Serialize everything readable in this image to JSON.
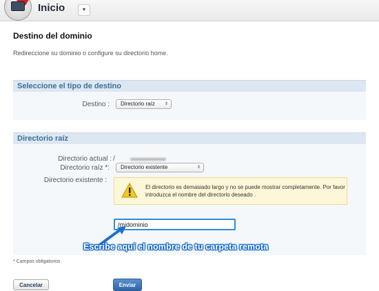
{
  "header": {
    "title": "Inicio",
    "logo_icon": "plesk-home-icon",
    "menu_caret": "▼"
  },
  "page": {
    "title": "Destino del dominio",
    "subtitle": "Redireccione su dominio o configure su directorio home."
  },
  "destination_section": {
    "header": "Seleccione el tipo de destino",
    "destino_label": "Destino :",
    "destino_value": "Directorio raíz"
  },
  "root_section": {
    "header": "Directorio raíz",
    "current_dir_label": "Directorio actual :",
    "current_dir_value": "/",
    "root_dir_label": "Directorio raíz *:",
    "root_dir_value": "Directorio existente",
    "existing_dir_label": "Directorio existente :",
    "warning_text": "El directorio es demasiado largo y no se puede mostrar completamente. Por favor introduzca el nombre del directorio deseado .",
    "input_value": "/midominio",
    "callout": "Escribe aquí el nombre de tu carpeta remota"
  },
  "footer": {
    "required_note": "* Campos obligatorios",
    "cancel_label": "Cancelar",
    "submit_label": "Enviar"
  },
  "colors": {
    "section_header_text": "#3e6f96",
    "accent_blue": "#2e8bd7",
    "warning_bg": "#fdf7d9",
    "submit_bg": "#2d66a9"
  }
}
